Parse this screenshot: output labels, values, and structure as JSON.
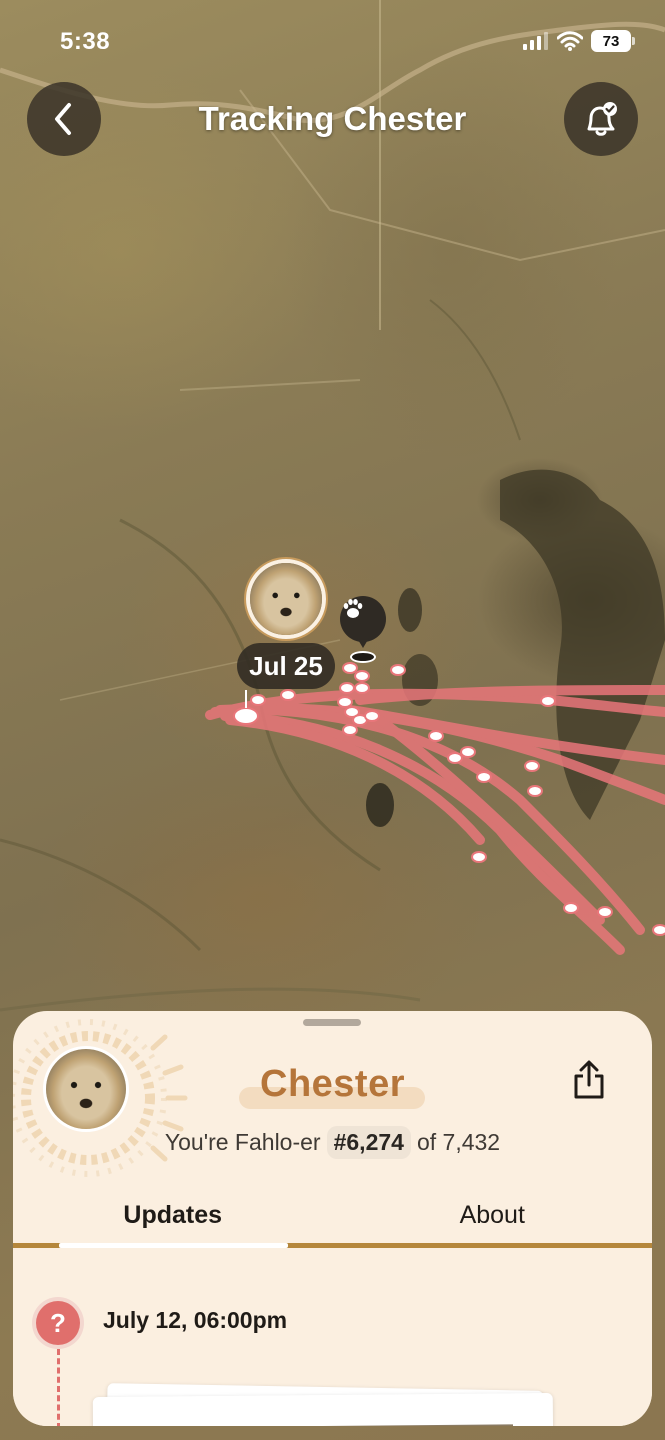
{
  "status_bar": {
    "time": "5:38",
    "battery": "73",
    "icons": [
      "cellular-signal-icon",
      "wifi-icon",
      "battery-icon"
    ]
  },
  "header": {
    "title": "Tracking Chester",
    "back_icon": "chevron-left-icon",
    "notify_icon": "bell-check-icon"
  },
  "map": {
    "type": "satellite",
    "latest_label": "Jul 25",
    "track_color": "#e8767a",
    "marker_icons": [
      "cheetah-avatar",
      "paw-icon"
    ]
  },
  "profile": {
    "name": "Chester",
    "rank_prefix": "You're Fahlo-er",
    "rank": "#6,274",
    "rank_suffix": "of 7,432",
    "share_icon": "share-icon"
  },
  "tabs": [
    {
      "label": "Updates",
      "active": true
    },
    {
      "label": "About",
      "active": false
    }
  ],
  "updates": [
    {
      "icon": "?",
      "timestamp": "July 12, 06:00pm"
    }
  ],
  "colors": {
    "accent": "#b5753a",
    "sheet_bg": "#fbefe0",
    "tab_line": "#b5873c",
    "update_red": "#e06f6c"
  }
}
